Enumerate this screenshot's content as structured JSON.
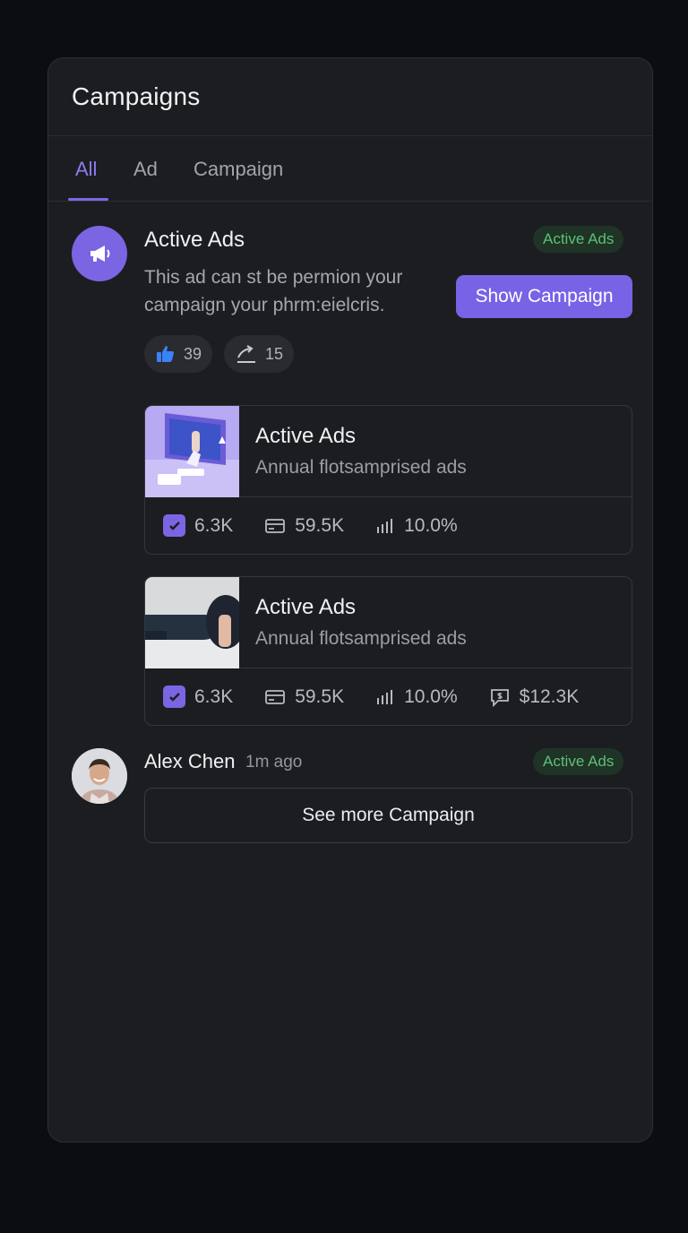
{
  "panel": {
    "title": "Campaigns"
  },
  "tabs": [
    {
      "label": "All",
      "active": true
    },
    {
      "label": "Ad",
      "active": false
    },
    {
      "label": "Campaign",
      "active": false
    }
  ],
  "post": {
    "icon": "megaphone-icon",
    "title": "Active Ads",
    "badge": "Active Ads",
    "description": "This ad can st be permion your campaign your phrm:eielcris.",
    "button_label": "Show Campaign",
    "likes": "39",
    "shares": "15"
  },
  "cards": [
    {
      "title": "Active Ads",
      "subtitle": "Annual flotsamprised ads",
      "stats": [
        {
          "icon": "checkbox-icon",
          "value": "6.3K"
        },
        {
          "icon": "card-icon",
          "value": "59.5K"
        },
        {
          "icon": "bar-chart-icon",
          "value": "10.0%"
        }
      ]
    },
    {
      "title": "Active Ads",
      "subtitle": "Annual flotsamprised ads",
      "stats": [
        {
          "icon": "checkbox-icon",
          "value": "6.3K"
        },
        {
          "icon": "card-icon",
          "value": "59.5K"
        },
        {
          "icon": "bar-chart-icon",
          "value": "10.0%"
        },
        {
          "icon": "chat-dollar-icon",
          "value": "$12.3K"
        }
      ]
    }
  ],
  "user": {
    "name": "Alex Chen",
    "time": "1m ago",
    "badge": "Active Ads"
  },
  "more_button": "See more Campaign",
  "colors": {
    "accent": "#7862e6",
    "badge_bg": "#1f3326",
    "badge_text": "#5fbf76",
    "panel_bg": "#1c1d21",
    "page_bg": "#0b0d10"
  }
}
